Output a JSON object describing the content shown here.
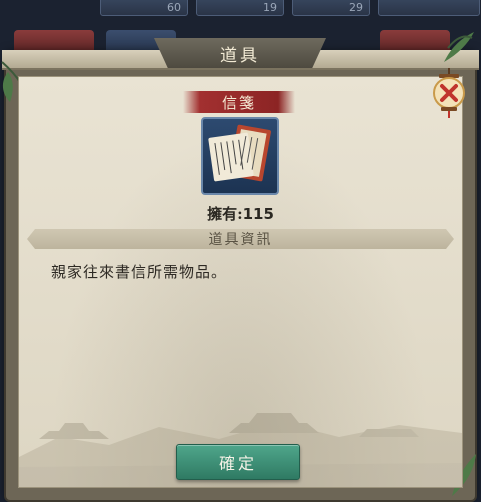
{
  "background": {
    "slot_counts": [
      "60",
      "19",
      "29"
    ]
  },
  "dialog": {
    "title": "道具",
    "item_name": "信箋",
    "owned_label": "擁有:",
    "owned_count": "115",
    "info_header": "道具資訊",
    "description": "親家往來書信所需物品。",
    "confirm_label": "確定",
    "close_icon": "close-lantern-icon"
  },
  "colors": {
    "ribbon_red": "#a23030",
    "confirm_green": "#3f9076",
    "panel_paper": "#e6e0cf"
  }
}
